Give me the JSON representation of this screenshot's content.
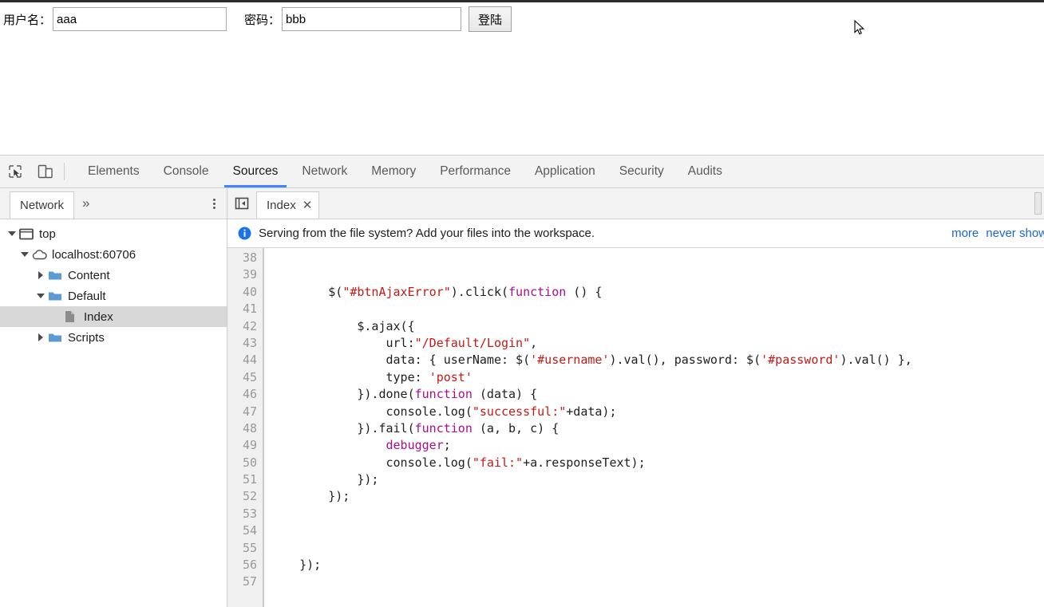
{
  "page": {
    "form": {
      "username_label": "用户名：",
      "username_value": "aaa",
      "username_placeholder": "",
      "password_label": "密码：",
      "password_value": "bbb",
      "password_placeholder": "",
      "login_button": "登陆"
    }
  },
  "devtools": {
    "main_tabs": [
      {
        "label": "Elements",
        "selected": false
      },
      {
        "label": "Console",
        "selected": false
      },
      {
        "label": "Sources",
        "selected": true
      },
      {
        "label": "Network",
        "selected": false
      },
      {
        "label": "Memory",
        "selected": false
      },
      {
        "label": "Performance",
        "selected": false
      },
      {
        "label": "Application",
        "selected": false
      },
      {
        "label": "Security",
        "selected": false
      },
      {
        "label": "Audits",
        "selected": false
      }
    ],
    "icons": {
      "inspect": "inspect-element-icon",
      "device": "device-toolbar-icon",
      "menu": "more-options-icon",
      "more_tabs": "more-tabs-chevron-icon",
      "collapse": "collapse-navigator-icon",
      "info": "info-icon"
    },
    "navigator": {
      "tab_label": "Network",
      "more_tabs": "»",
      "tree": [
        {
          "label": "top",
          "depth": 0,
          "twisty": "down",
          "icon": "frame-icon",
          "selected": false
        },
        {
          "label": "localhost:60706",
          "depth": 1,
          "twisty": "down",
          "icon": "cloud-icon",
          "selected": false
        },
        {
          "label": "Content",
          "depth": 2,
          "twisty": "right",
          "icon": "folder-icon",
          "selected": false
        },
        {
          "label": "Default",
          "depth": 2,
          "twisty": "down",
          "icon": "folder-icon",
          "selected": false
        },
        {
          "label": "Index",
          "depth": 3,
          "twisty": "none",
          "icon": "file-icon",
          "selected": true
        },
        {
          "label": "Scripts",
          "depth": 2,
          "twisty": "right",
          "icon": "folder-icon",
          "selected": false
        }
      ]
    },
    "editor": {
      "tab_label": "Index",
      "tab_close": "✕",
      "info_bar": {
        "message": "Serving from the file system? Add your files into the workspace.",
        "link_more": "more",
        "link_never": "never show"
      },
      "first_line_number": 38,
      "lines": [
        {
          "n": 38,
          "tokens": []
        },
        {
          "n": 39,
          "tokens": []
        },
        {
          "n": 40,
          "tokens": [
            {
              "t": "        $(",
              "c": "plain"
            },
            {
              "t": "\"#btnAjaxError\"",
              "c": "str"
            },
            {
              "t": ").click(",
              "c": "plain"
            },
            {
              "t": "function",
              "c": "kw"
            },
            {
              "t": " () {",
              "c": "plain"
            }
          ]
        },
        {
          "n": 41,
          "tokens": []
        },
        {
          "n": 42,
          "tokens": [
            {
              "t": "            $.ajax({",
              "c": "plain"
            }
          ]
        },
        {
          "n": 43,
          "tokens": [
            {
              "t": "                url:",
              "c": "plain"
            },
            {
              "t": "\"/Default/Login\"",
              "c": "str"
            },
            {
              "t": ",",
              "c": "plain"
            }
          ]
        },
        {
          "n": 44,
          "tokens": [
            {
              "t": "                data: { userName: $(",
              "c": "plain"
            },
            {
              "t": "'#username'",
              "c": "str"
            },
            {
              "t": ").val(), password: $(",
              "c": "plain"
            },
            {
              "t": "'#password'",
              "c": "str"
            },
            {
              "t": ").val() },",
              "c": "plain"
            }
          ]
        },
        {
          "n": 45,
          "tokens": [
            {
              "t": "                type: ",
              "c": "plain"
            },
            {
              "t": "'post'",
              "c": "str"
            }
          ]
        },
        {
          "n": 46,
          "tokens": [
            {
              "t": "            }).done(",
              "c": "plain"
            },
            {
              "t": "function",
              "c": "kw"
            },
            {
              "t": " (data) {",
              "c": "plain"
            }
          ]
        },
        {
          "n": 47,
          "tokens": [
            {
              "t": "                console.log(",
              "c": "plain"
            },
            {
              "t": "\"successful:\"",
              "c": "str"
            },
            {
              "t": "+data);",
              "c": "plain"
            }
          ]
        },
        {
          "n": 48,
          "tokens": [
            {
              "t": "            }).fail(",
              "c": "plain"
            },
            {
              "t": "function",
              "c": "kw"
            },
            {
              "t": " (a, b, c) {",
              "c": "plain"
            }
          ]
        },
        {
          "n": 49,
          "tokens": [
            {
              "t": "                ",
              "c": "plain"
            },
            {
              "t": "debugger",
              "c": "kw"
            },
            {
              "t": ";",
              "c": "plain"
            }
          ]
        },
        {
          "n": 50,
          "tokens": [
            {
              "t": "                console.log(",
              "c": "plain"
            },
            {
              "t": "\"fail:\"",
              "c": "str"
            },
            {
              "t": "+a.responseText);",
              "c": "plain"
            }
          ]
        },
        {
          "n": 51,
          "tokens": [
            {
              "t": "            });",
              "c": "plain"
            }
          ]
        },
        {
          "n": 52,
          "tokens": [
            {
              "t": "        });",
              "c": "plain"
            }
          ]
        },
        {
          "n": 53,
          "tokens": []
        },
        {
          "n": 54,
          "tokens": []
        },
        {
          "n": 55,
          "tokens": []
        },
        {
          "n": 56,
          "tokens": [
            {
              "t": "    });",
              "c": "plain"
            }
          ]
        },
        {
          "n": 57,
          "tokens": []
        }
      ]
    }
  },
  "colors": {
    "accent": "#4285f4",
    "link": "#1967d2",
    "string": "#c41a16",
    "keyword": "#aa0d91",
    "folder": "#5b9bd5",
    "selection": "#d8d8d8"
  }
}
